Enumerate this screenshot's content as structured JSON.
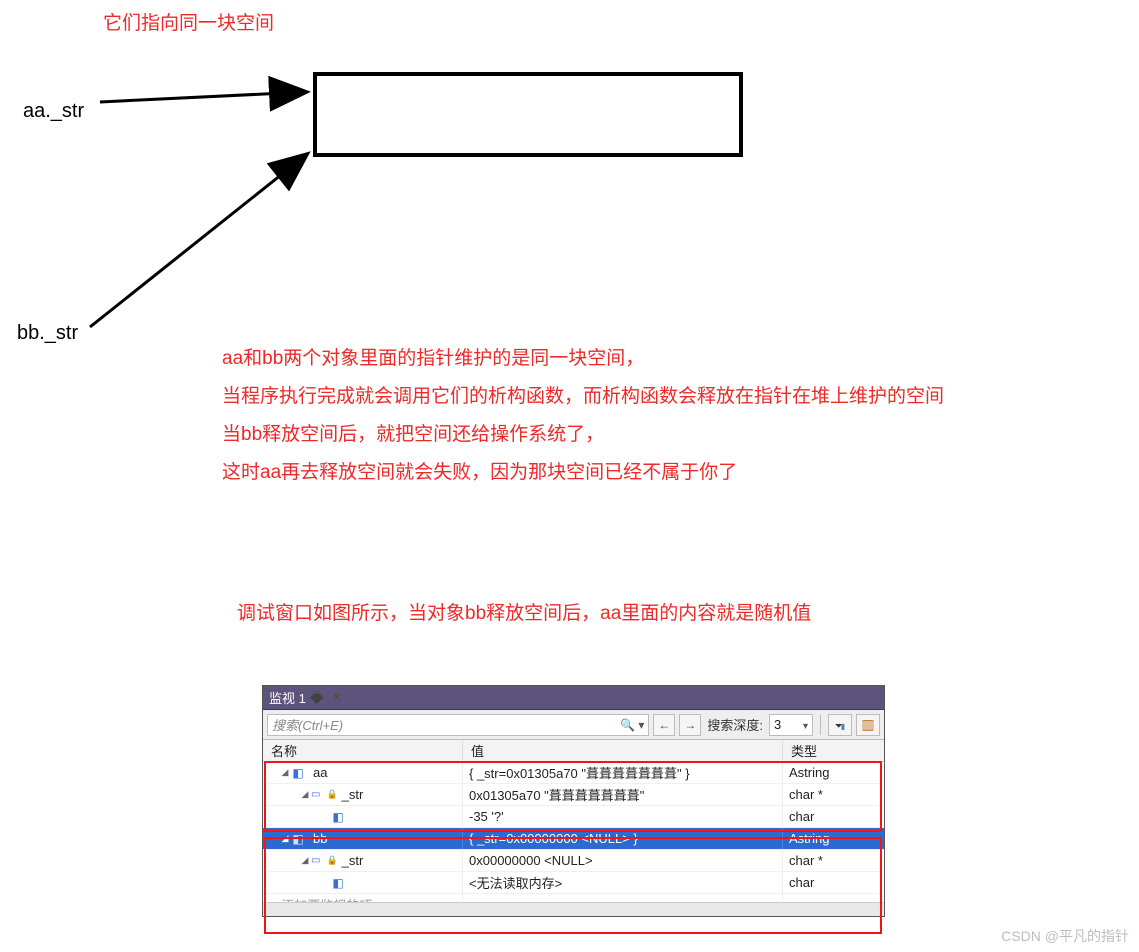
{
  "title": "它们指向同一块空间",
  "labels": {
    "aa": "aa._str",
    "bb": "bb._str"
  },
  "explain": {
    "l1": "aa和bb两个对象里面的指针维护的是同一块空间，",
    "l2": "当程序执行完成就会调用它们的析构函数，而析构函数会释放在指针在堆上维护的空间",
    "l3": "当bb释放空间后，就把空间还给操作系统了，",
    "l4": "这时aa再去释放空间就会失败，因为那块空间已经不属于你了"
  },
  "caption": "调试窗口如图所示，当对象bb释放空间后，aa里面的内容就是随机值",
  "watch": {
    "panel_title": "监视 1",
    "search_placeholder": "搜索(Ctrl+E)",
    "nav_prev": "←",
    "nav_next": "→",
    "depth_label": "搜索深度:",
    "depth_value": "3",
    "header": {
      "name": "名称",
      "value": "值",
      "type": "类型"
    },
    "rows": [
      {
        "depth": 1,
        "expander": "open",
        "icon": "cube",
        "name": "aa",
        "value": "{ _str=0x01305a70 \"葺葺葺葺葺葺葺\" }",
        "type": "Astring",
        "selected": false
      },
      {
        "depth": 2,
        "expander": "open",
        "icon": "field",
        "name": "_str",
        "value": "0x01305a70 \"葺葺葺葺葺葺葺\"",
        "type": "char *",
        "selected": false
      },
      {
        "depth": 3,
        "expander": "none",
        "icon": "cube",
        "name": "",
        "value": "-35 '?'",
        "type": "char",
        "selected": false
      },
      {
        "depth": 1,
        "expander": "open",
        "icon": "cube",
        "name": "bb",
        "value": "{ _str=0x00000000 <NULL> }",
        "type": "Astring",
        "selected": true
      },
      {
        "depth": 2,
        "expander": "open",
        "icon": "field",
        "name": "_str",
        "value": "0x00000000 <NULL>",
        "type": "char *",
        "selected": false
      },
      {
        "depth": 3,
        "expander": "none",
        "icon": "cube",
        "name": "",
        "value": "<无法读取内存>",
        "type": "char",
        "selected": false
      }
    ],
    "add_row": "添加要监视的项"
  },
  "attribution": "CSDN @平凡的指针"
}
